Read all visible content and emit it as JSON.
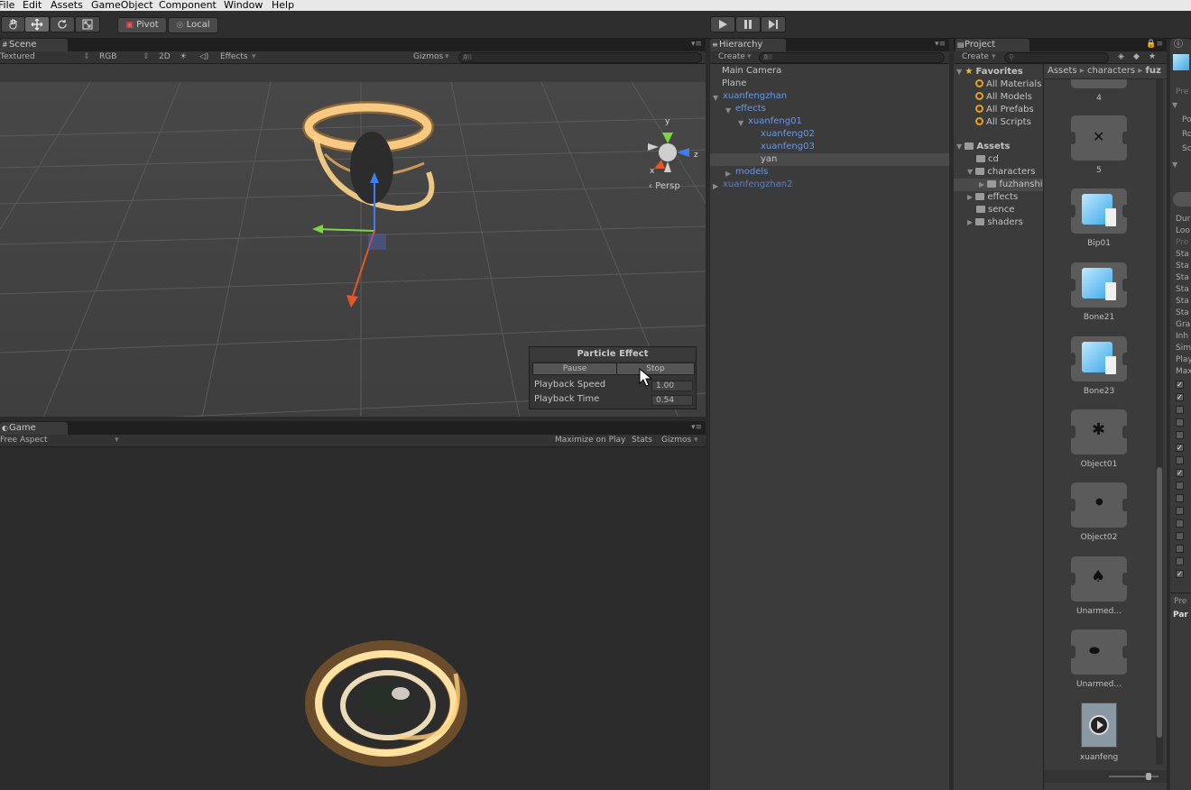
{
  "menu": [
    "File",
    "Edit",
    "Assets",
    "GameObject",
    "Component",
    "Window",
    "Help"
  ],
  "toolbar": {
    "pivot": "Pivot",
    "local": "Local"
  },
  "scene": {
    "tab": "Scene",
    "render_mode": "Textured",
    "color_mode": "RGB",
    "mode_2d": "2D",
    "effects": "Effects",
    "gizmos": "Gizmos",
    "search": "All",
    "persp": "Persp",
    "axis_y": "y",
    "axis_z": "z",
    "axis_x": "x"
  },
  "particle": {
    "title": "Particle Effect",
    "pause": "Pause",
    "stop": "Stop",
    "speed_label": "Playback Speed",
    "speed_value": "1.00",
    "time_label": "Playback Time",
    "time_value": "0.54"
  },
  "game": {
    "tab": "Game",
    "aspect": "Free Aspect",
    "maximize": "Maximize on Play",
    "stats": "Stats",
    "gizmos": "Gizmos"
  },
  "hierarchy": {
    "tab": "Hierarchy",
    "create": "Create",
    "search": "All",
    "items": [
      "Main Camera",
      "Plane",
      "xuanfengzhan",
      "effects",
      "xuanfeng01",
      "xuanfeng02",
      "xuanfeng03",
      "yan",
      "models",
      "xuanfengzhan2"
    ]
  },
  "project": {
    "tab": "Project",
    "create": "Create",
    "favorites": "Favorites",
    "fav_items": [
      "All Materials",
      "All Models",
      "All Prefabs",
      "All Scripts"
    ],
    "assets_root": "Assets",
    "folders": [
      "cd",
      "characters",
      "fuzhanshi",
      "effects",
      "sence",
      "shaders"
    ],
    "breadcrumb": [
      "Assets",
      "characters",
      "fuz"
    ],
    "assets": [
      "4",
      "5",
      "Bip01",
      "Bone21",
      "Bone23",
      "Object01",
      "Object02",
      "Unarmed...",
      "Unarmed...",
      "xuanfeng"
    ]
  },
  "inspector": {
    "labels": [
      "Pre",
      "Po",
      "Ro",
      "Sc",
      "Dur",
      "Loo",
      "Pre",
      "Sta",
      "Sta",
      "Sta",
      "Sta",
      "Sta",
      "Sta",
      "Gra",
      "Inh",
      "Sim",
      "Play",
      "Max",
      "Pre",
      "Par"
    ]
  }
}
